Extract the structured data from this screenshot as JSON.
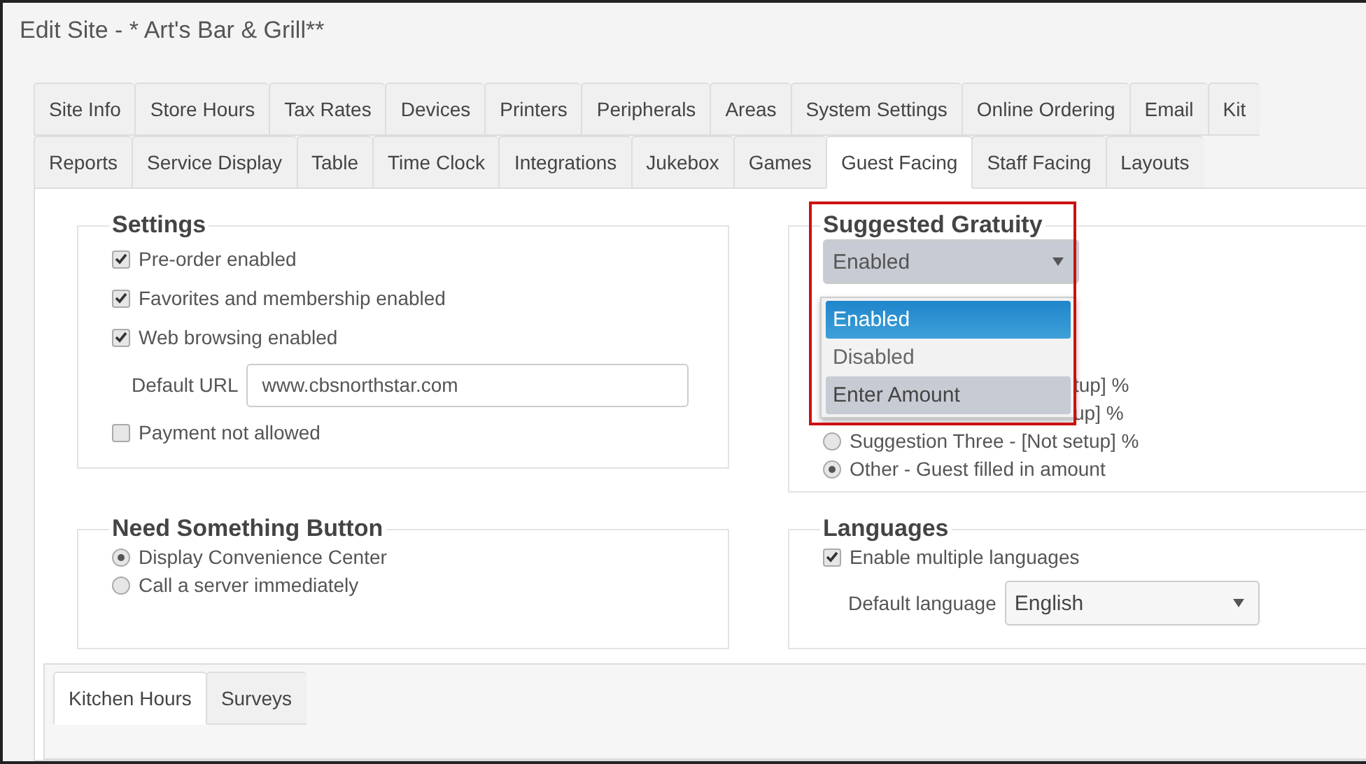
{
  "window": {
    "title": "Edit Site - * Art's Bar & Grill**"
  },
  "tab_rows": [
    [
      {
        "label": "Site Info",
        "selected": false
      },
      {
        "label": "Store Hours",
        "selected": false
      },
      {
        "label": "Tax Rates",
        "selected": false
      },
      {
        "label": "Devices",
        "selected": false
      },
      {
        "label": "Printers",
        "selected": false
      },
      {
        "label": "Peripherals",
        "selected": false
      },
      {
        "label": "Areas",
        "selected": false
      },
      {
        "label": "System Settings",
        "selected": false
      },
      {
        "label": "Online Ordering",
        "selected": false
      },
      {
        "label": "Email",
        "selected": false
      },
      {
        "label": "Kit",
        "selected": false
      }
    ],
    [
      {
        "label": "Reports",
        "selected": false
      },
      {
        "label": "Service Display",
        "selected": false
      },
      {
        "label": "Table",
        "selected": false
      },
      {
        "label": "Time Clock",
        "selected": false
      },
      {
        "label": "Integrations",
        "selected": false
      },
      {
        "label": "Jukebox",
        "selected": false
      },
      {
        "label": "Games",
        "selected": false
      },
      {
        "label": "Guest Facing",
        "selected": true
      },
      {
        "label": "Staff Facing",
        "selected": false
      },
      {
        "label": "Layouts",
        "selected": false
      }
    ]
  ],
  "settings": {
    "title": "Settings",
    "items": [
      {
        "kind": "checkbox",
        "label": "Pre-order enabled",
        "checked": true
      },
      {
        "kind": "checkbox",
        "label": "Favorites and membership enabled",
        "checked": true
      },
      {
        "kind": "checkbox",
        "label": "Web browsing enabled",
        "checked": true
      },
      {
        "kind": "field",
        "label": "Default URL",
        "value": "www.cbsnorthstar.com"
      },
      {
        "kind": "checkbox",
        "label": "Payment not allowed",
        "checked": false
      }
    ]
  },
  "suggested_gratuity": {
    "title": "Suggested Gratuity",
    "highlighted": true,
    "select": {
      "value": "Enabled",
      "expanded": true,
      "options": [
        {
          "label": "Enabled",
          "selected": true,
          "hovered": false
        },
        {
          "label": "Disabled",
          "selected": false,
          "hovered": false
        },
        {
          "label": "Enter Amount",
          "selected": false,
          "hovered": true
        }
      ]
    },
    "choices": [
      {
        "label": "tup] %",
        "covered": true
      },
      {
        "label": "up] %",
        "covered": true
      },
      {
        "label": "Suggestion Three - [Not setup] %",
        "selected": false,
        "covered": false
      },
      {
        "label": "Other - Guest filled in amount",
        "selected": true,
        "covered": false
      }
    ]
  },
  "need_something": {
    "title": "Need Something Button",
    "choices": [
      {
        "label": "Display Convenience Center",
        "selected": true
      },
      {
        "label": "Call a server immediately",
        "selected": false
      }
    ]
  },
  "languages": {
    "title": "Languages",
    "checkbox": {
      "label": "Enable multiple languages",
      "checked": true
    },
    "default_language": {
      "label": "Default language",
      "value": "English"
    }
  },
  "bottom_tabs": [
    {
      "label": "Kitchen Hours",
      "selected": true
    },
    {
      "label": "Surveys",
      "selected": false
    }
  ]
}
